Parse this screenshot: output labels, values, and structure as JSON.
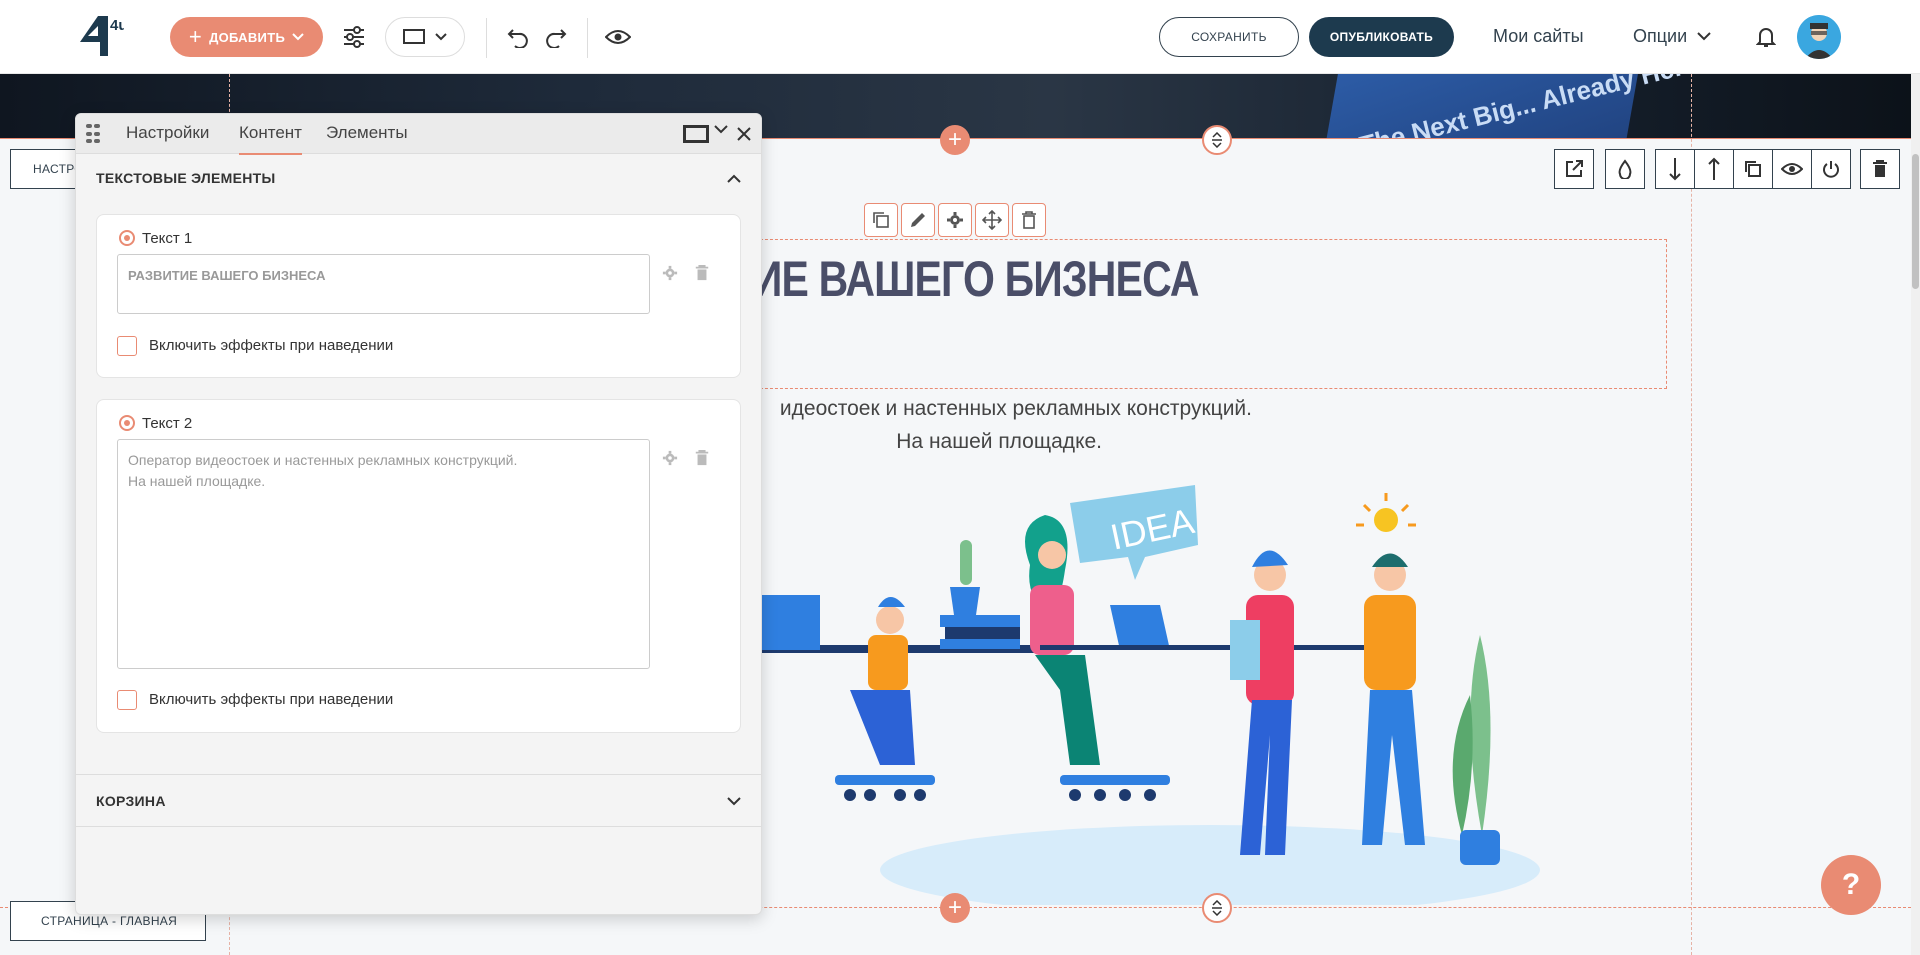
{
  "toolbar": {
    "logo_text": "4u",
    "add_label": "ДОБАВИТЬ",
    "save_label": "СОХРАНИТЬ",
    "publish_label": "ОПУБЛИКОВАТЬ",
    "my_sites_label": "Мои сайты",
    "options_label": "Опции"
  },
  "hero": {
    "banner_text": "The Next Big... Already Here"
  },
  "content": {
    "title": "ИТИЕ ВАШЕГО БИЗНЕСА",
    "subtitle_line1": "идеостоек и настенных рекламных конструкций.",
    "subtitle_line2": "На нашей площадке.",
    "idea_bubble": "IDEA"
  },
  "left_tags": {
    "settings_label": "НАСТРО",
    "page_label": "СТРАНИЦА - ГЛАВНАЯ"
  },
  "help_label": "?",
  "panel": {
    "tabs": [
      "Настройки",
      "Контент",
      "Элементы"
    ],
    "active_tab": "Контент",
    "section1_title": "ТЕКСТОВЫЕ ЭЛЕМЕНТЫ",
    "text1": {
      "label": "Текст 1",
      "value": "РАЗВИТИЕ ВАШЕГО БИЗНЕСА",
      "hover_label": "Включить эффекты при наведении"
    },
    "text2": {
      "label": "Текст 2",
      "value": "Оператор видеостоек и настенных рекламных конструкций.\nНа нашей площадке.",
      "hover_label": "Включить эффекты при наведении"
    },
    "section2_title": "КОРЗИНА"
  },
  "colors": {
    "accent": "#e98b73",
    "dark": "#1d3a4e",
    "title": "#4a4e68"
  }
}
